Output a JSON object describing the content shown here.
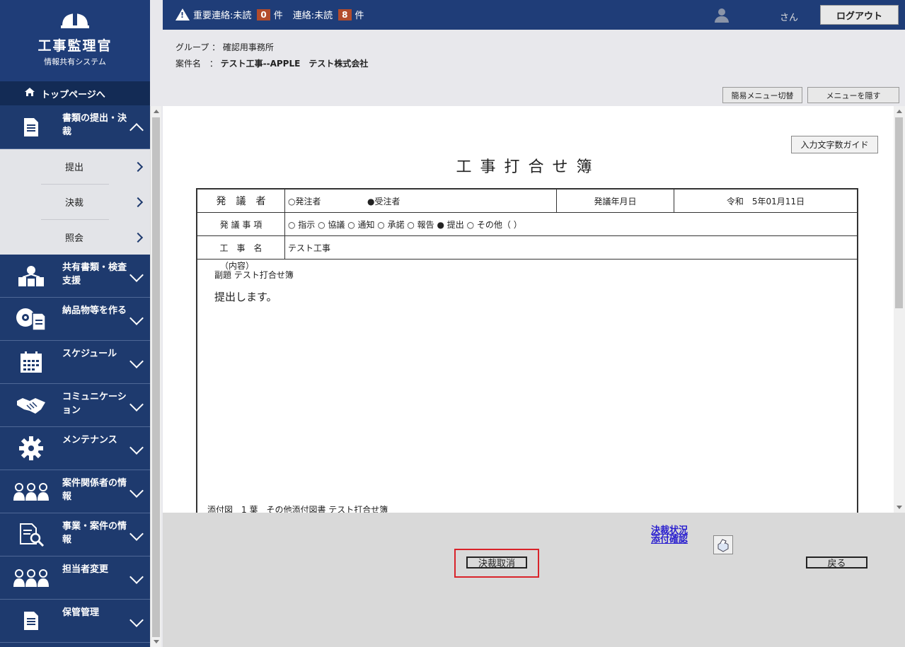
{
  "app": {
    "title": "工事監理官",
    "subtitle": "情報共有システム"
  },
  "sidebar": {
    "top_link": "トップページへ",
    "items": [
      {
        "label": "書類の提出・決裁",
        "icon": "document-icon",
        "expanded": true
      },
      {
        "label": "共有書類・検査支援",
        "icon": "share-network-icon"
      },
      {
        "label": "納品物等を作る",
        "icon": "disc-document-icon"
      },
      {
        "label": "スケジュール",
        "icon": "calendar-icon"
      },
      {
        "label": "コミュニケーション",
        "icon": "handshake-icon"
      },
      {
        "label": "メンテナンス",
        "icon": "gear-icon"
      },
      {
        "label": "案件関係者の情報",
        "icon": "people-icon"
      },
      {
        "label": "事業・案件の情報",
        "icon": "document-search-icon"
      },
      {
        "label": "担当者変更",
        "icon": "people-swap-icon"
      },
      {
        "label": "保管管理",
        "icon": "document-archive-icon"
      }
    ],
    "sub_items": [
      "提出",
      "決裁",
      "照会"
    ]
  },
  "topbar": {
    "important_label": "重要連絡:未読",
    "important_count": "0",
    "unit": "件",
    "contact_label": "連絡:未読",
    "contact_count": "8",
    "user_suffix": "さん",
    "logout": "ログアウト"
  },
  "header": {
    "group_label": "グループ",
    "group_value": "確認用事務所",
    "project_label": "案件名",
    "project_value": "テスト工事--APPLE　テスト株式会社",
    "simple_menu_button": "簡易メニュー切替",
    "hide_menu_button": "メニューを隠す"
  },
  "document": {
    "guide_button": "入力文字数ガイド",
    "title": "工事打合せ簿",
    "row1": {
      "label": "発　議　者",
      "option_orderer": "○発注者",
      "option_contractor": "●受注者",
      "date_label": "発議年月日",
      "date_value": "令和　5年01月11日"
    },
    "row2": {
      "label": "発 議 事 項",
      "options": "○ 指示 ○ 協議 ○ 通知 ○ 承諾 ○ 報告 ● 提出 ○ その他（ ）"
    },
    "row3": {
      "label": "工　事　名",
      "value": "テスト工事"
    },
    "content_label": "（内容）",
    "subject": "副題 テスト打合せ簿",
    "body": "提出します。",
    "attachment": "添付図　1 葉　その他添付図書 テスト打合せ簿"
  },
  "actions": {
    "status_link_line1": "決裁状況",
    "status_link_line2": "添付確認",
    "cancel_approval": "決裁取消",
    "back": "戻る"
  },
  "colors": {
    "sidebar_bg": "#1e3a6e",
    "badge": "#b24b2c",
    "highlight_frame": "#d9232a",
    "link": "#2a1fcf"
  }
}
